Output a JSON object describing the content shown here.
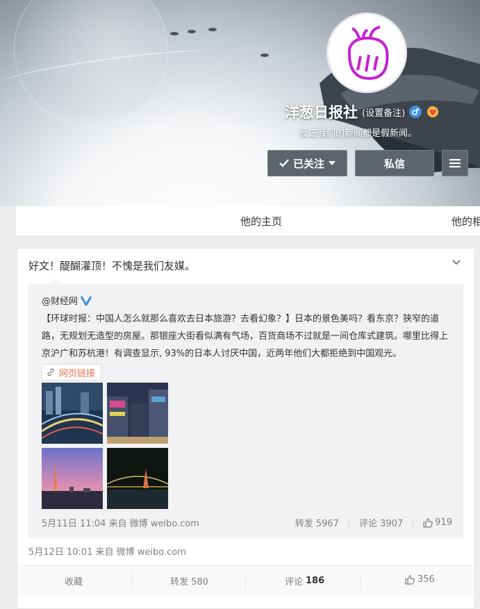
{
  "profile": {
    "name": "洋葱日报社",
    "remark": "(设置备注)",
    "bio": "反正我们的新闻都是假新闻。"
  },
  "buttons": {
    "follow": "已关注",
    "message": "私信"
  },
  "tabs": [
    "他的主页",
    "他的相"
  ],
  "post": {
    "text": "好文！醍醐灌顶！不愧是我们友媒。",
    "repost": {
      "author": "@财经网",
      "text": "【环球时报：中国人怎么就那么喜欢去日本旅游？去看幻象？】日本的景色美吗？看东京？狭窄的道路，无规划无造型的房屋。那银座大街看似满有气场，百货商场不过就是一间仓库式建筑。哪里比得上京沪广和苏杭港！有调查显示, 93%的日本人讨厌中国，近两年他们大都拒绝到中国观光。",
      "link_label": "网页链接",
      "time": "5月11日 11:04 来自 微博 weibo.com",
      "forward": "转发 5967",
      "comment": "评论 3907",
      "likes": "919"
    },
    "time": "5月12日 10:01 来自 微博 weibo.com",
    "actions": {
      "collect": "收藏",
      "forward": "转发 580",
      "comment_label": "评论",
      "comment_count": "186",
      "likes": "356"
    }
  },
  "colors": {
    "accent": "#eb7350",
    "verified": "#3d8fdc",
    "avatar_stroke": "#c81fd6"
  }
}
